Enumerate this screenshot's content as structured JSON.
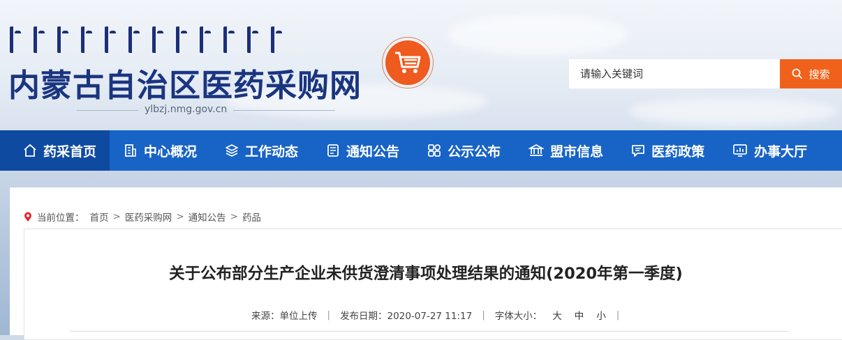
{
  "header": {
    "site_title": "内蒙古自治区医药采购网",
    "domain": "ylbzj.nmg.gov.cn",
    "logo_icon": "shopping-cart-icon",
    "accent_color": "#f0621b"
  },
  "search": {
    "placeholder": "请输入关键词",
    "button_label": "搜索",
    "icon": "search-icon"
  },
  "nav": {
    "items": [
      {
        "label": "药采首页",
        "icon": "home-icon",
        "active": true
      },
      {
        "label": "中心概况",
        "icon": "building-icon"
      },
      {
        "label": "工作动态",
        "icon": "layers-icon"
      },
      {
        "label": "通知公告",
        "icon": "document-list-icon"
      },
      {
        "label": "公示公布",
        "icon": "grid-icon"
      },
      {
        "label": "盟市信息",
        "icon": "bank-icon"
      },
      {
        "label": "医药政策",
        "icon": "message-icon"
      },
      {
        "label": "办事大厅",
        "icon": "chart-board-icon"
      }
    ],
    "color": "#1863c6",
    "active_color": "#0f4aa1"
  },
  "breadcrumb": {
    "prefix": "当前位置：",
    "items": [
      "首页",
      "医药采购网",
      "通知公告",
      "药品"
    ],
    "separator": ">",
    "icon": "location-pin-icon"
  },
  "article": {
    "title": "关于公布部分生产企业未供货澄清事项处理结果的通知(2020年第一季度)",
    "source": "来源：单位上传",
    "date": "发布日期：2020-07-27 11:17",
    "font_size_label": "字体大小：",
    "font_sizes": [
      "大",
      "中",
      "小"
    ]
  }
}
